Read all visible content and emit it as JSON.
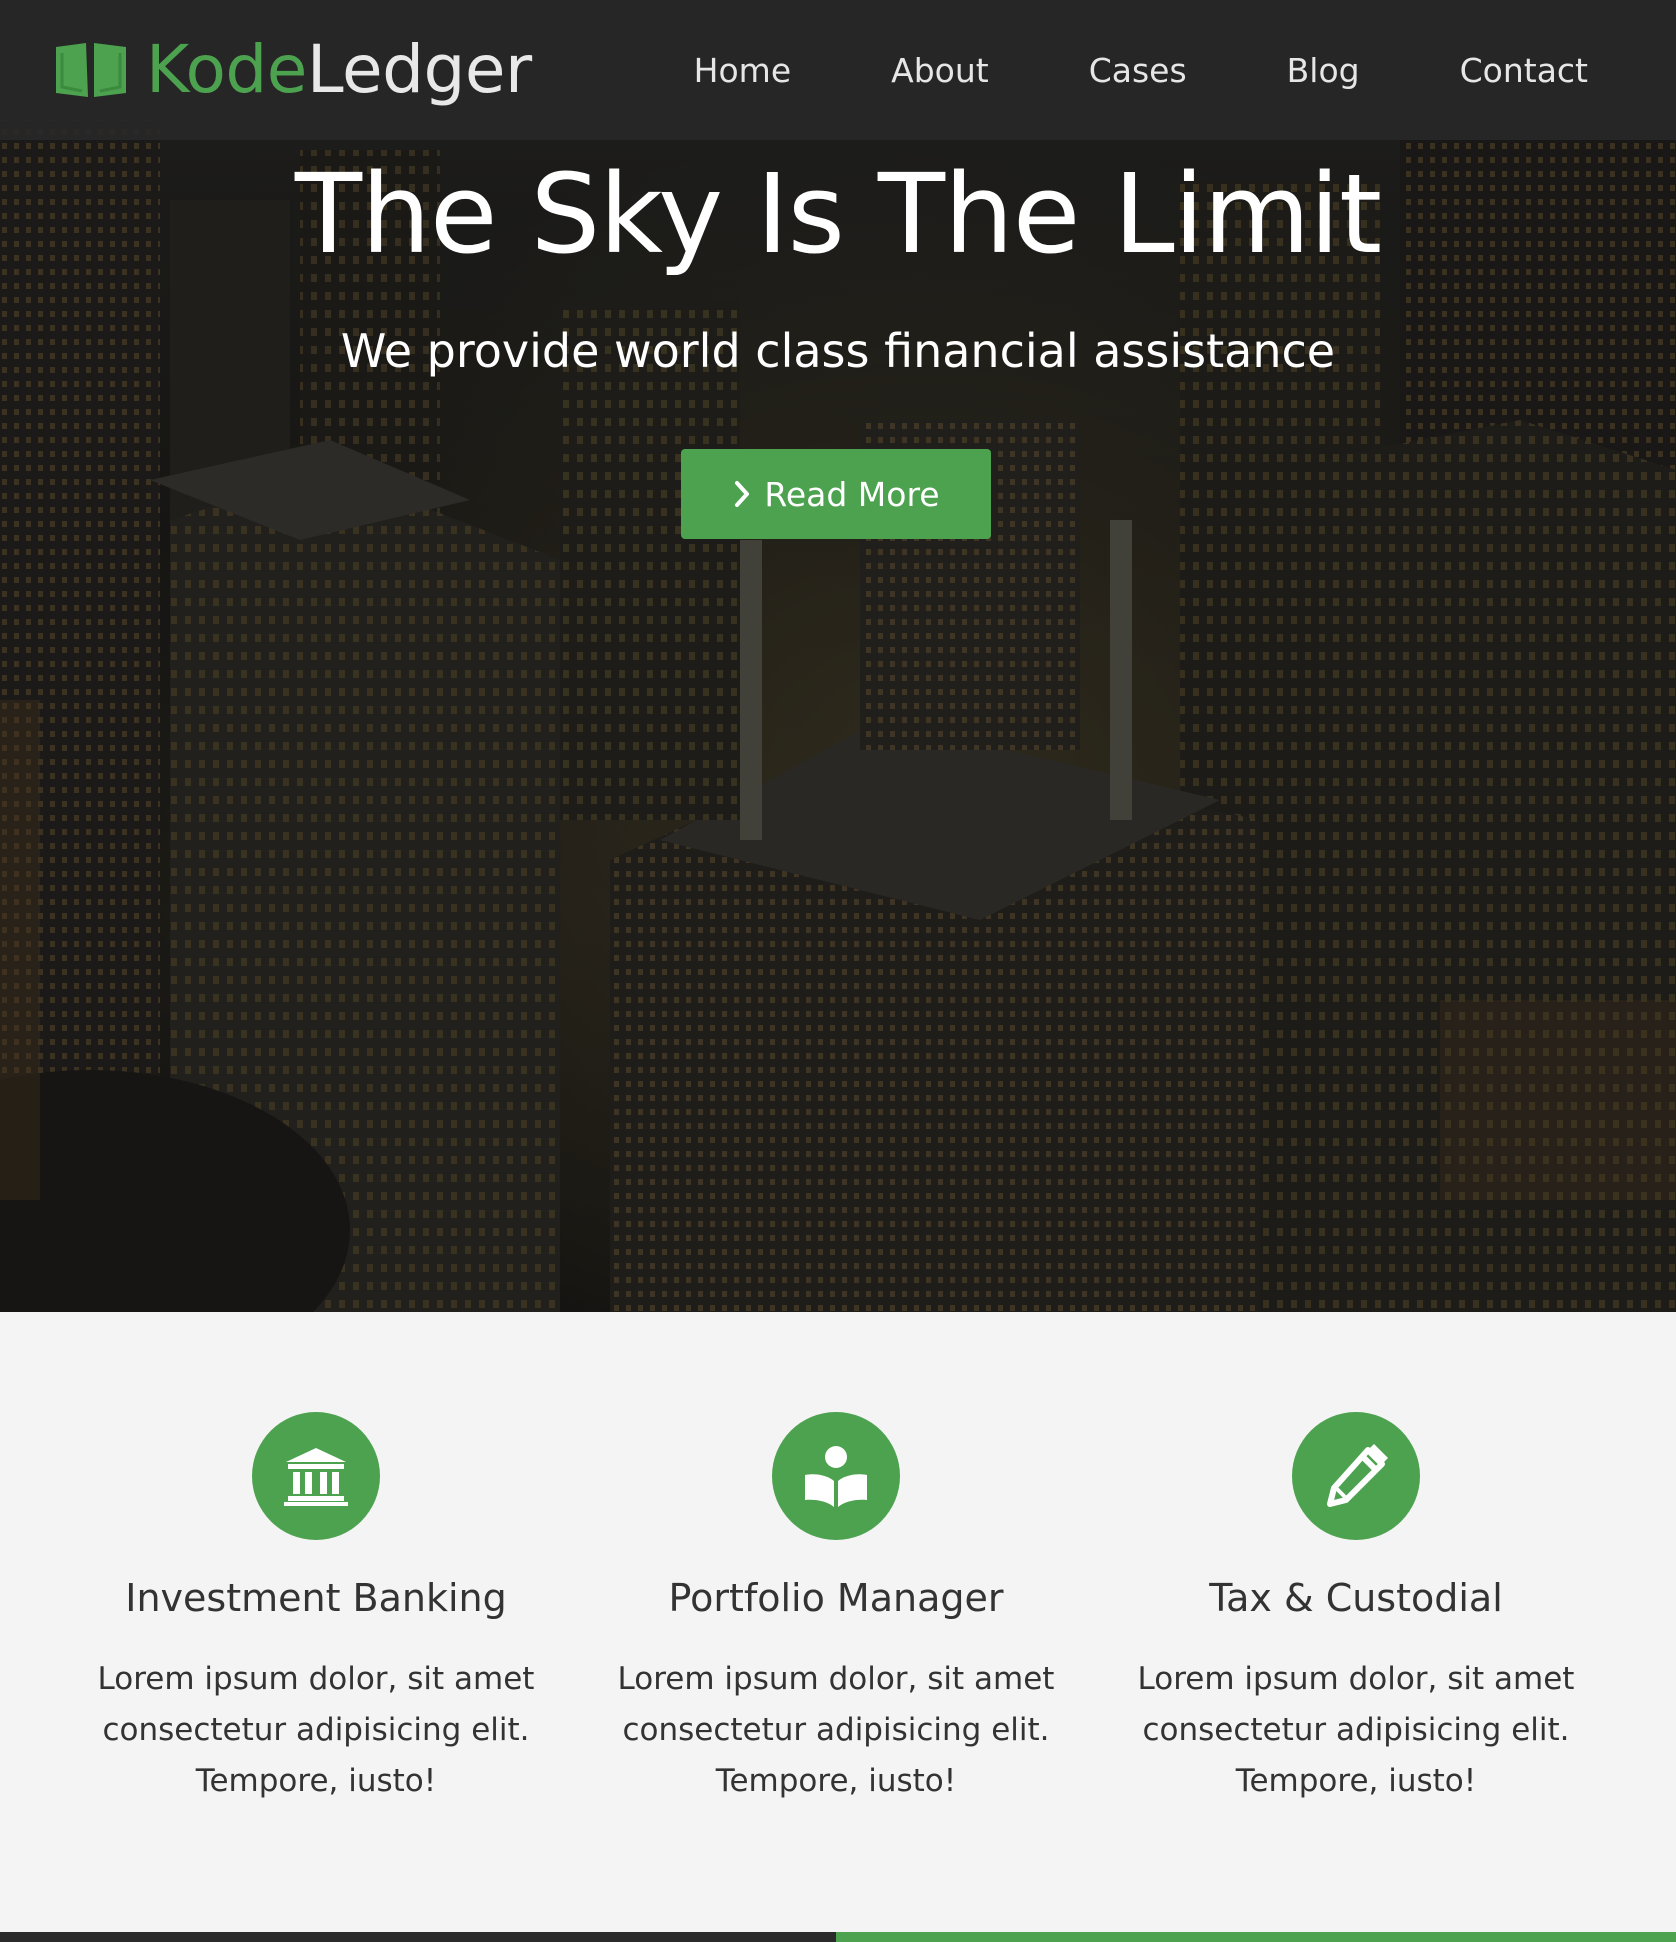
{
  "brand": {
    "part1": "Kode",
    "part2": "Ledger",
    "icon": "open-book-icon"
  },
  "nav": {
    "items": [
      {
        "label": "Home"
      },
      {
        "label": "About"
      },
      {
        "label": "Cases"
      },
      {
        "label": "Blog"
      },
      {
        "label": "Contact"
      }
    ]
  },
  "hero": {
    "title": "The Sky Is The Limit",
    "subtitle": "We provide world class financial assistance",
    "button_label": "Read More",
    "button_icon": "chevron-right-icon"
  },
  "features": [
    {
      "icon": "bank-icon",
      "title": "Investment Banking",
      "text_line1": "Lorem ipsum dolor, sit amet",
      "text_line2": "consectetur adipisicing elit.",
      "text_line3": "Tempore, iusto!"
    },
    {
      "icon": "book-reader-icon",
      "title": "Portfolio Manager",
      "text_line1": "Lorem ipsum dolor, sit amet",
      "text_line2": "consectetur adipisicing elit.",
      "text_line3": "Tempore, iusto!"
    },
    {
      "icon": "pencil-icon",
      "title": "Tax & Custodial",
      "text_line1": "Lorem ipsum dolor, sit amet",
      "text_line2": "consectetur adipisicing elit.",
      "text_line3": "Tempore, iusto!"
    }
  ],
  "colors": {
    "accent": "#4ca24f",
    "navbar_bg": "#282828",
    "section_bg": "#f4f4f4",
    "text_dark": "#333333"
  }
}
